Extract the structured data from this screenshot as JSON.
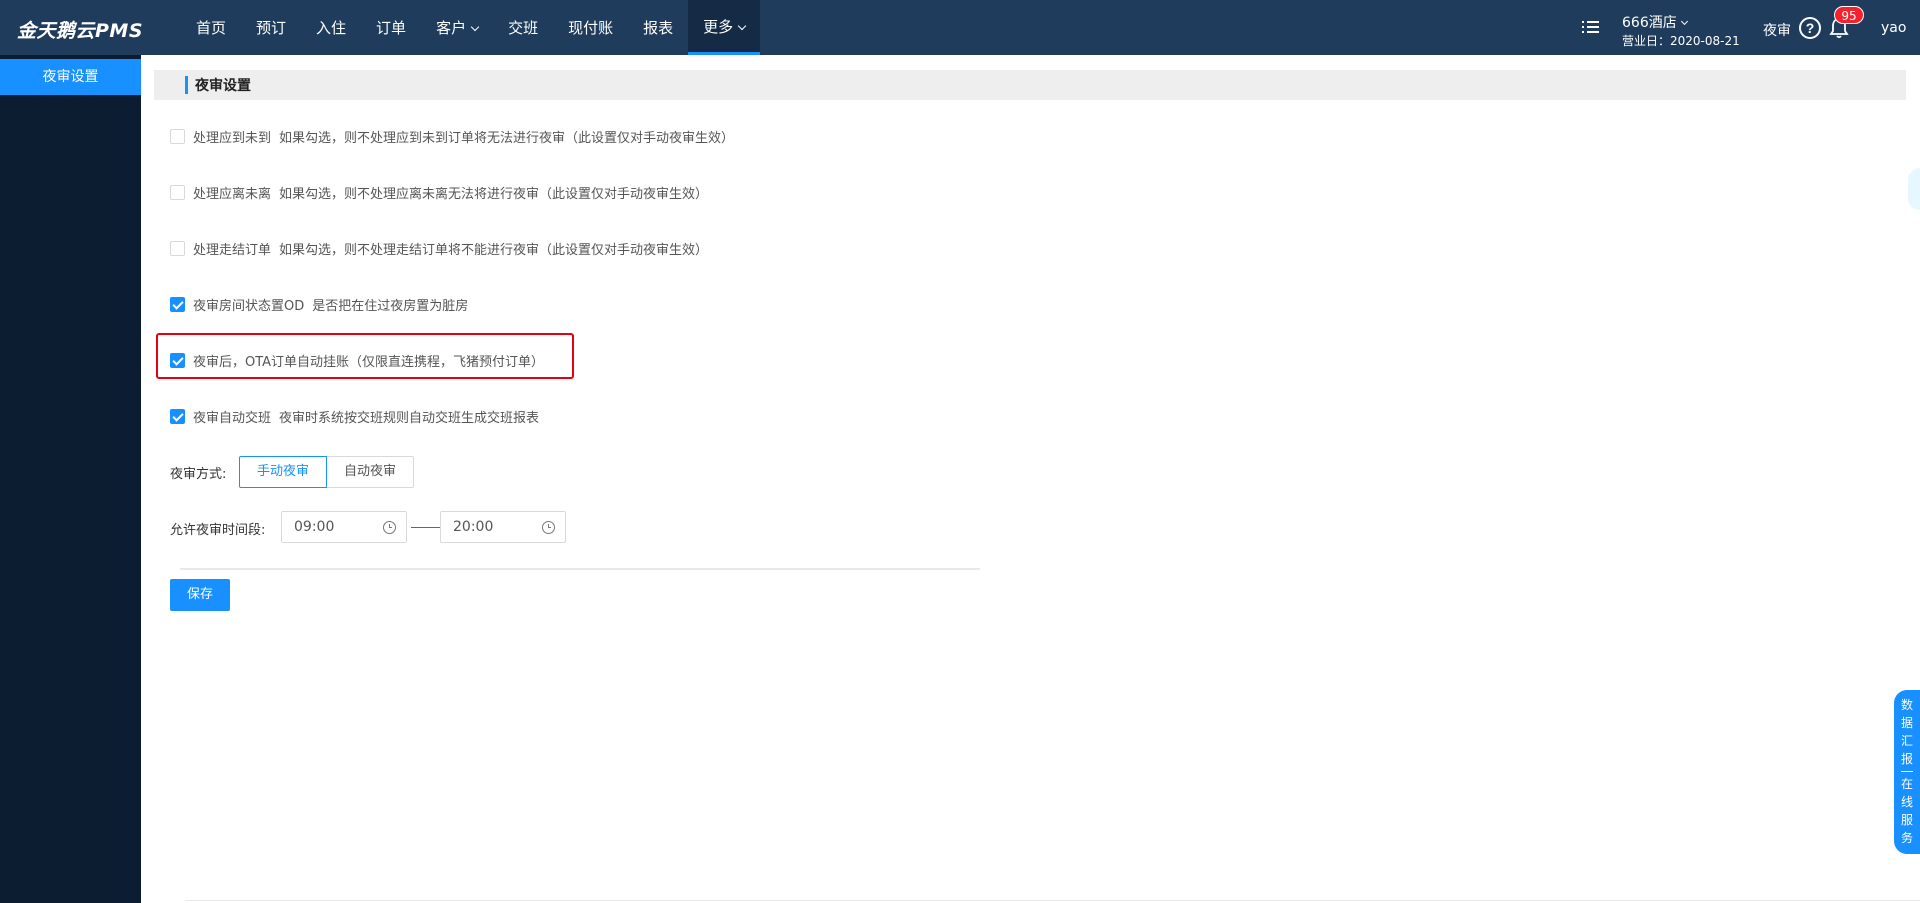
{
  "app": {
    "logo": "金天鹅云PMS"
  },
  "nav": {
    "items": [
      {
        "label": "首页",
        "dropdown": false,
        "active": false
      },
      {
        "label": "预订",
        "dropdown": false,
        "active": false
      },
      {
        "label": "入住",
        "dropdown": false,
        "active": false
      },
      {
        "label": "订单",
        "dropdown": false,
        "active": false
      },
      {
        "label": "客户",
        "dropdown": true,
        "active": false
      },
      {
        "label": "交班",
        "dropdown": false,
        "active": false
      },
      {
        "label": "现付账",
        "dropdown": false,
        "active": false
      },
      {
        "label": "报表",
        "dropdown": false,
        "active": false
      },
      {
        "label": "更多",
        "dropdown": true,
        "active": true
      }
    ]
  },
  "header_right": {
    "hotel_name": "666酒店",
    "business_date": "营业日：2020-08-21",
    "night_audit_label": "夜审",
    "help_icon": "question-circle-icon",
    "notification_icon": "bell-icon",
    "notification_count": "95",
    "username": "yao"
  },
  "sidebar": {
    "items": [
      {
        "label": "夜审设置",
        "active": true
      }
    ]
  },
  "section": {
    "title": "夜审设置"
  },
  "options": [
    {
      "label": "处理应到未到",
      "desc": "如果勾选，则不处理应到未到订单将无法进行夜审（此设置仅对手动夜审生效）",
      "checked": false
    },
    {
      "label": "处理应离未离",
      "desc": "如果勾选，则不处理应离未离无法将进行夜审（此设置仅对手动夜审生效）",
      "checked": false
    },
    {
      "label": "处理走结订单",
      "desc": "如果勾选，则不处理走结订单将不能进行夜审（此设置仅对手动夜审生效）",
      "checked": false
    },
    {
      "label": "夜审房间状态置OD",
      "desc": "是否把在住过夜房置为脏房",
      "checked": true
    },
    {
      "label": "夜审后，OTA订单自动挂账（仅限直连携程，飞猪预付订单）",
      "desc": "",
      "checked": true
    },
    {
      "label": "夜审自动交班",
      "desc": "夜审时系统按交班规则自动交班生成交班报表",
      "checked": true
    }
  ],
  "audit_mode": {
    "label": "夜审方式:",
    "options": [
      "手动夜审",
      "自动夜审"
    ],
    "selected": "手动夜审"
  },
  "time_range": {
    "label": "允许夜审时间段:",
    "start": "09:00",
    "end": "20:00",
    "icon": "clock-icon"
  },
  "actions": {
    "save_label": "保存"
  },
  "float_service": {
    "top_text": [
      "数",
      "据",
      "汇",
      "报"
    ],
    "bottom_text": [
      "在",
      "线",
      "服",
      "务"
    ]
  },
  "colors": {
    "topbar": "#1f3c5c",
    "sidebar": "#0d1d31",
    "accent": "#1890ff",
    "highlight_border": "#e60012",
    "badge": "#f5222d"
  }
}
